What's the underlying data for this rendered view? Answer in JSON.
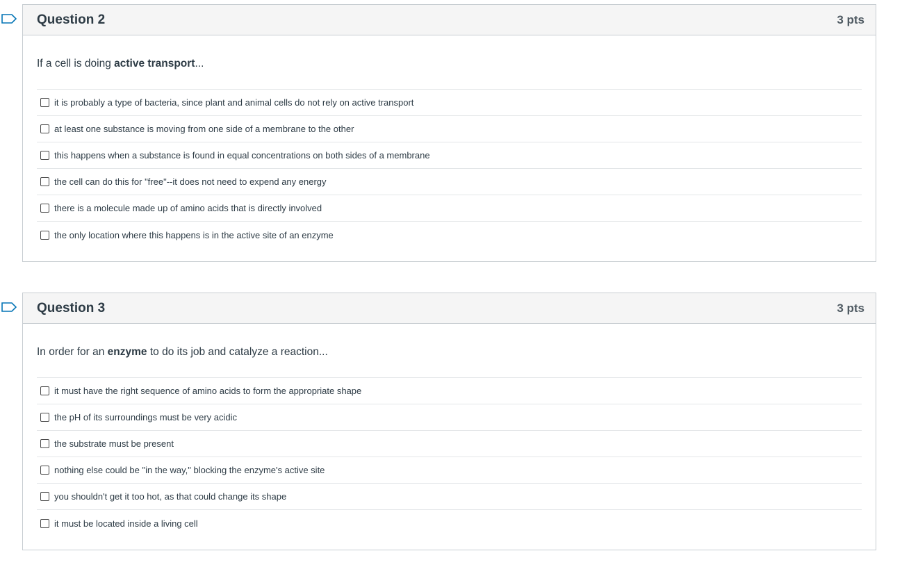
{
  "questions": [
    {
      "title": "Question 2",
      "points": "3 pts",
      "prompt_before": "If a cell is doing ",
      "prompt_bold": "active transport",
      "prompt_after": "...",
      "answers": [
        "it is probably a type of bacteria, since plant and animal cells do not rely on active transport",
        "at least one substance is moving from one side of a membrane to the other",
        "this happens when a substance is found in equal concentrations on both sides of a membrane",
        "the cell can do this for \"free\"--it does not need to expend any energy",
        "there is a molecule made up of amino acids that is directly involved",
        "the only location where this happens is in the active site of an enzyme"
      ]
    },
    {
      "title": "Question 3",
      "points": "3 pts",
      "prompt_before": "In order for an ",
      "prompt_bold": "enzyme",
      "prompt_after": " to do its job and catalyze a reaction...",
      "answers": [
        "it must have the right sequence of amino acids to form the appropriate shape",
        "the pH of its surroundings must be very acidic",
        "the substrate must be present",
        "nothing else could be \"in the way,\" blocking the enzyme's active site",
        "you shouldn't get it too hot, as that could change its shape",
        "it must be located inside a living cell"
      ]
    }
  ],
  "icons": {
    "flag": "flag-bookmark-icon"
  },
  "colors": {
    "flag": "#0374b5",
    "header_bg": "#f5f5f5",
    "border": "#c7cdd1",
    "text": "#2d3b45"
  }
}
